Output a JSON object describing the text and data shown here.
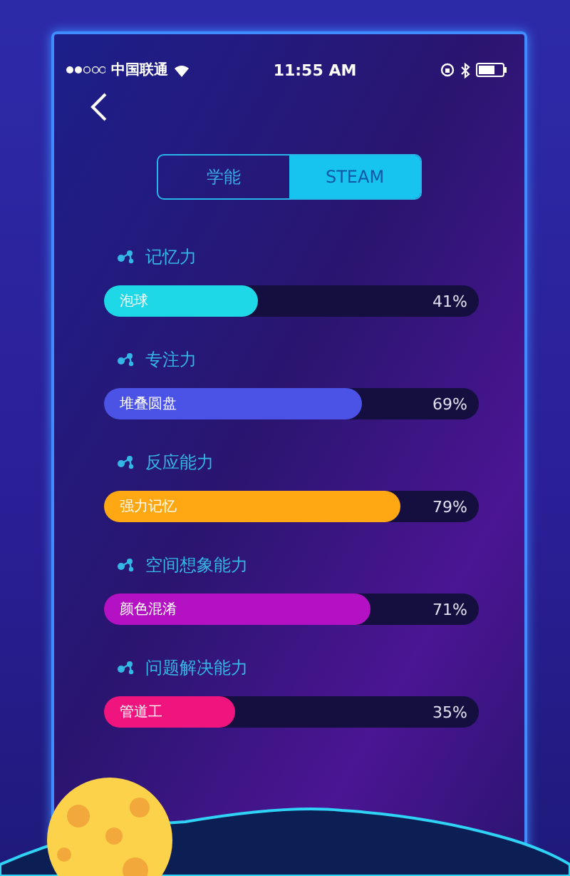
{
  "status_bar": {
    "carrier": "中国联通",
    "time": "11:55 AM"
  },
  "tabs": [
    {
      "label": "学能",
      "selected": false
    },
    {
      "label": "STEAM",
      "selected": true
    }
  ],
  "abilities": [
    {
      "title": "记忆力",
      "game": "泡球",
      "level": 0.41,
      "reading": "41%",
      "color": "#1ed8e8"
    },
    {
      "title": "专注力",
      "game": "堆叠圆盘",
      "level": 0.69,
      "reading": "69%",
      "color": "#4b52e6"
    },
    {
      "title": "反应能力",
      "game": "强力记忆",
      "level": 0.79,
      "reading": "79%",
      "color": "#ffa814"
    },
    {
      "title": "空间想象能力",
      "game": "颜色混淆",
      "level": 0.71,
      "reading": "71%",
      "color": "#b511c4"
    },
    {
      "title": "问题解决能力",
      "game": "管道工",
      "level": 0.35,
      "reading": "35%",
      "color": "#f0157e"
    }
  ]
}
